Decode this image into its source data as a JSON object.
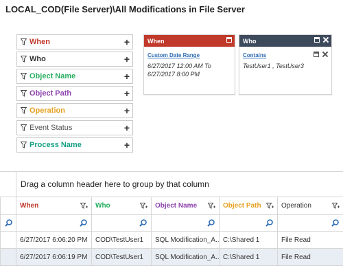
{
  "page": {
    "title": "LOCAL_COD(File Server)\\All Modifications in File Server"
  },
  "filters": [
    {
      "label": "When",
      "color": "#c0392b"
    },
    {
      "label": "Who",
      "color": "#333333"
    },
    {
      "label": "Object Name",
      "color": "#27ae60"
    },
    {
      "label": "Object Path",
      "color": "#8e44ad"
    },
    {
      "label": "Operation",
      "color": "#e6a020"
    },
    {
      "label": "Event Status",
      "color": "#555555"
    },
    {
      "label": "Process Name",
      "color": "#16a085"
    }
  ],
  "cards": {
    "when": {
      "title": "When",
      "header_color": "#c0392b",
      "link": "Custom Date Range",
      "value": "6/27/2017 12:00 AM To 6/27/2017 8:00 PM"
    },
    "who": {
      "title": "Who",
      "header_color": "#3d4a5c",
      "link": "Contains",
      "value": "TestUser1 , TestUser3"
    }
  },
  "grid": {
    "group_hint": "Drag a column header here to group by that column",
    "columns": [
      {
        "label": "When",
        "color": "#c0392b"
      },
      {
        "label": "Who",
        "color": "#27ae60"
      },
      {
        "label": "Object Name",
        "color": "#8e44ad"
      },
      {
        "label": "Object Path",
        "color": "#e6a020"
      },
      {
        "label": "Operation",
        "color": "#333333"
      }
    ],
    "rows": [
      [
        "6/27/2017 6:06:20 PM",
        "COD\\TestUser1",
        "SQL Modification_A...",
        "C:\\Shared 1",
        "File Read"
      ],
      [
        "6/27/2017 6:06:19 PM",
        "COD\\TestUser1",
        "SQL Modification_A...",
        "C:\\Shared 1",
        "File Read"
      ]
    ]
  }
}
